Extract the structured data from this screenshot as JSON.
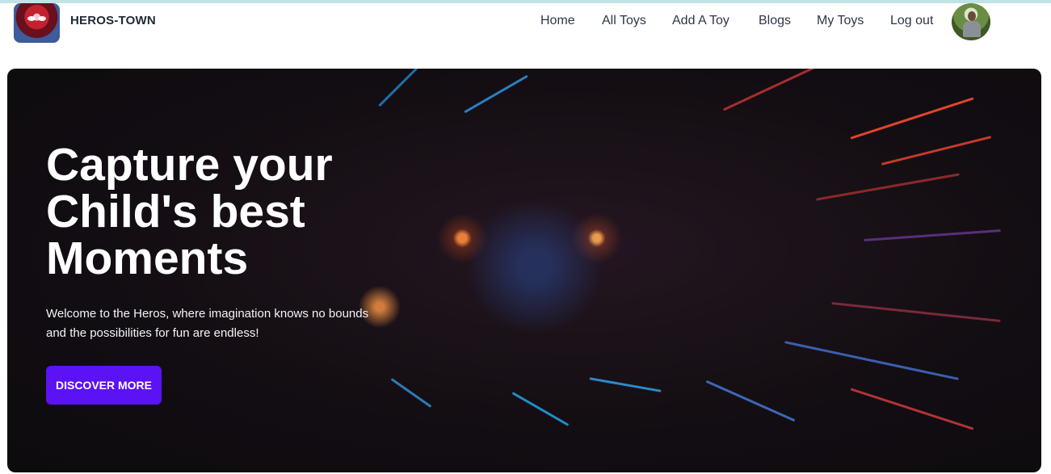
{
  "navbar": {
    "brand": "HEROS-TOWN",
    "logo_icon": "spiderman-logo-image",
    "links": [
      {
        "label": "Home"
      },
      {
        "label": "All Toys"
      },
      {
        "label": "Add A Toy"
      },
      {
        "label": "Blogs"
      },
      {
        "label": "My Toys"
      },
      {
        "label": "Log out"
      }
    ],
    "avatar_icon": "user-avatar-image"
  },
  "hero": {
    "title_lines": [
      "Capture your",
      "Child's best",
      "Moments"
    ],
    "description_lines": [
      "Welcome to the Heros, where imagination knows no bounds",
      "and the possibilities for fun are endless!"
    ],
    "cta_label": "DISCOVER MORE",
    "colors": {
      "cta_background": "#5b12f5",
      "hero_background": "#120d12",
      "text": "#ffffff"
    }
  }
}
